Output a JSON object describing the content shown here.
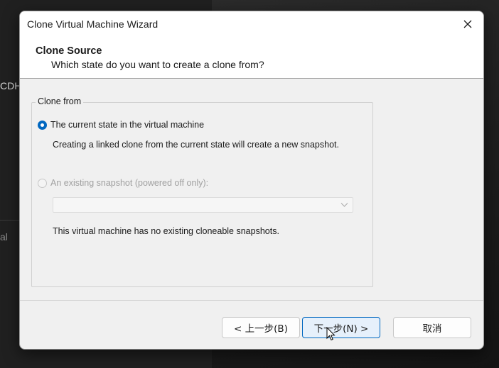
{
  "background": {
    "left_text_1": "CDH",
    "left_text_2": "al"
  },
  "dialog": {
    "title": "Clone Virtual Machine Wizard",
    "close_icon": "close-icon"
  },
  "header": {
    "title": "Clone Source",
    "subtitle": "Which state do you want to create a clone from?"
  },
  "clone_from": {
    "group_label": "Clone from",
    "option_current": {
      "label": "The current state in the virtual machine",
      "selected": true,
      "description": "Creating a linked clone from the current state will create a new snapshot."
    },
    "option_snapshot": {
      "label": "An existing snapshot (powered off only):",
      "selected": false,
      "enabled": false,
      "dropdown_value": "",
      "note": "This virtual machine has no existing cloneable snapshots."
    }
  },
  "buttons": {
    "back": "< 上一步(B)",
    "next": "下一步(N) >",
    "cancel": "取消"
  },
  "colors": {
    "accent": "#0067c0",
    "dialog_bg": "#f0f0f0",
    "disabled_text": "#a0a0a0"
  }
}
